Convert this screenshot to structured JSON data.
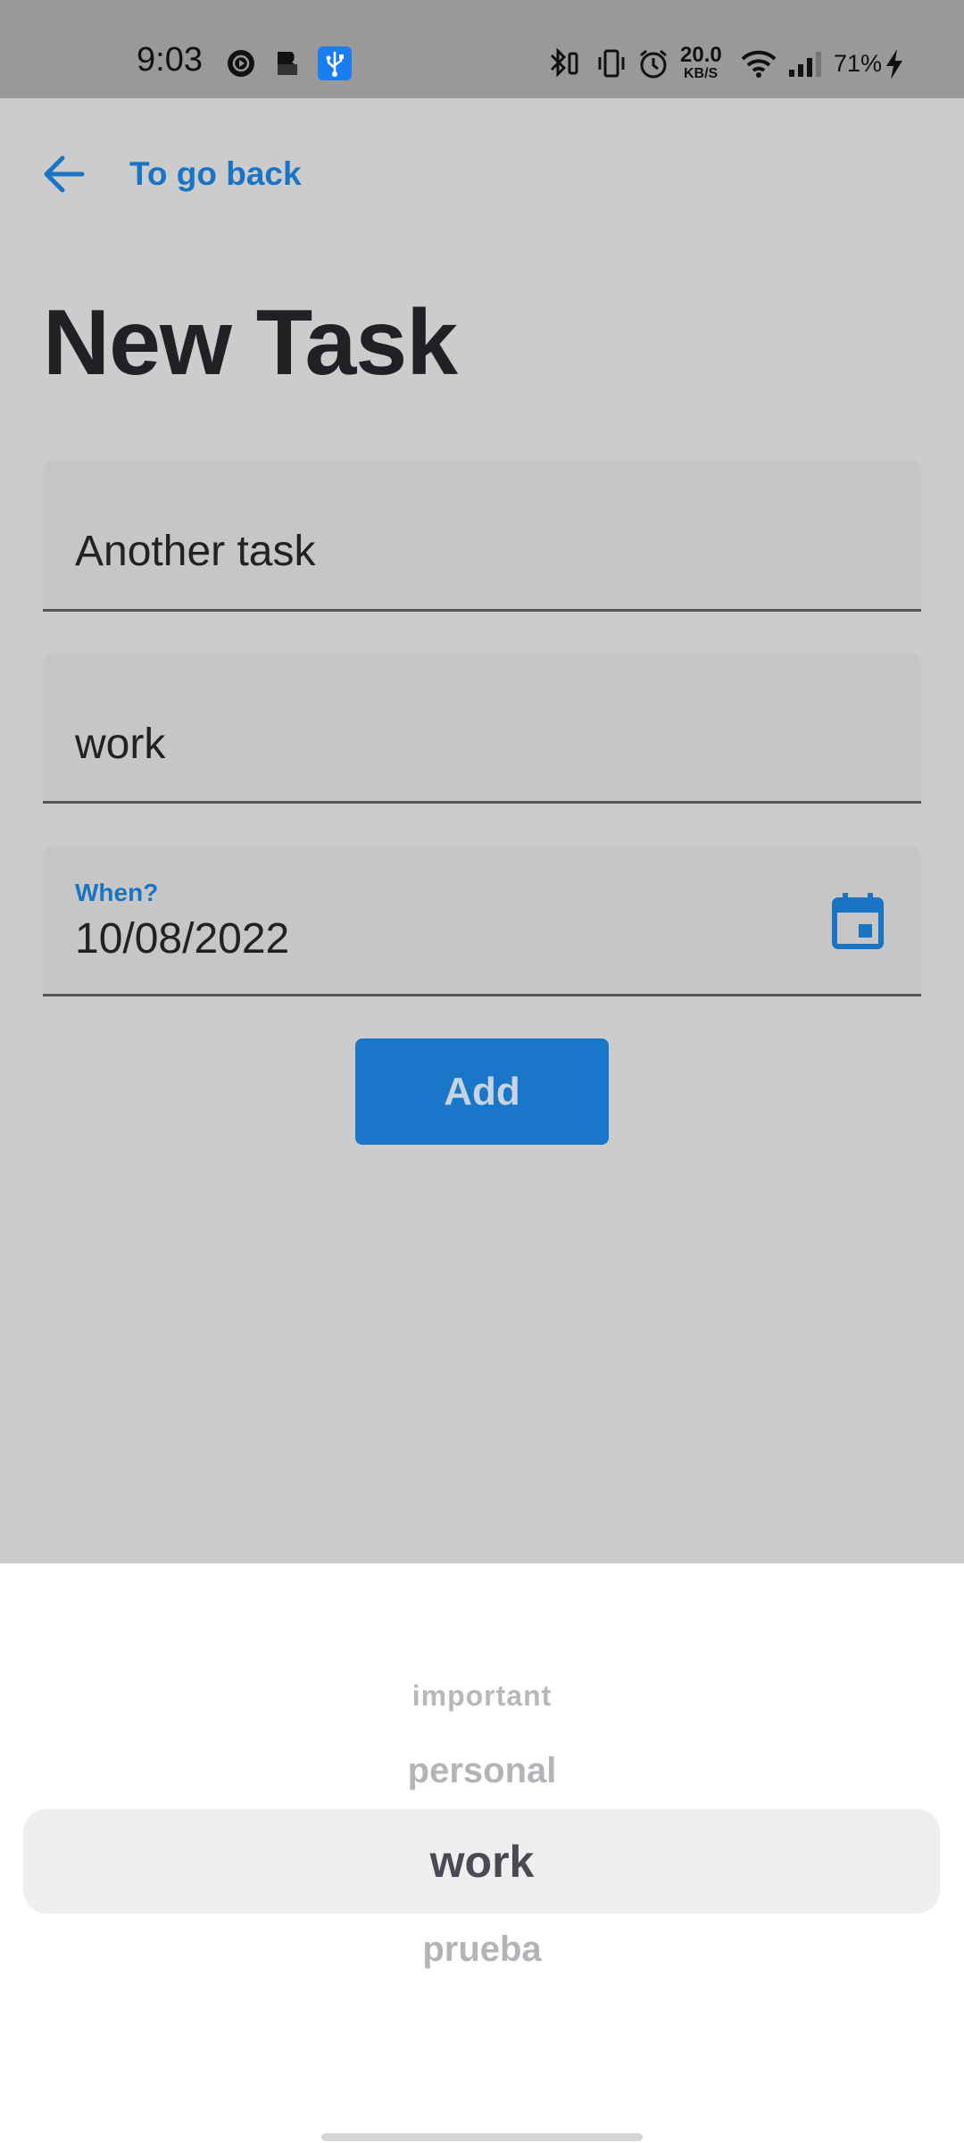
{
  "status_bar": {
    "time": "9:03",
    "network_speed_value": "20.0",
    "network_speed_unit": "KB/S",
    "battery_percent": "71%",
    "icons": [
      "media-play-icon",
      "app-b-icon",
      "usb-icon",
      "bluetooth-icon",
      "vibrate-icon",
      "alarm-icon",
      "wifi-icon",
      "signal-icon",
      "charging-bolt-icon"
    ]
  },
  "nav": {
    "back_label": "To go back"
  },
  "page": {
    "title": "New Task"
  },
  "form": {
    "task_name_value": "Another task",
    "category_value": "work",
    "date_label": "When?",
    "date_value": "10/08/2022",
    "add_label": "Add"
  },
  "picker": {
    "items": [
      "important",
      "personal",
      "work",
      "prueba"
    ],
    "selected": "work"
  },
  "colors": {
    "accent": "#1976c8",
    "scrim_background": "#cccccc",
    "status_bar": "#999999",
    "sheet": "#ffffff"
  }
}
